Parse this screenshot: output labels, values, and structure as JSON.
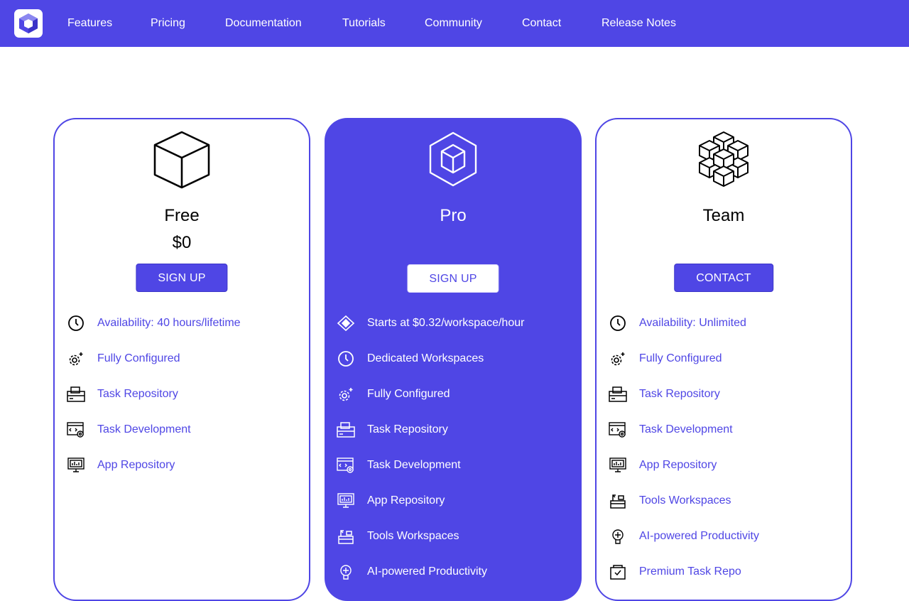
{
  "nav": {
    "logo_icon": "hexagon-cube-logo-icon",
    "links": [
      "Features",
      "Pricing",
      "Documentation",
      "Tutorials",
      "Community",
      "Contact",
      "Release Notes"
    ]
  },
  "colors": {
    "accent": "#4f46e5",
    "white": "#ffffff",
    "text": "#000000"
  },
  "plans": [
    {
      "name": "Free",
      "price": "$0",
      "button": "SIGN UP",
      "icon": "cube-icon",
      "features": [
        {
          "icon": "clock-icon",
          "label": "Availability: 40 hours/lifetime"
        },
        {
          "icon": "gear-sparkle-icon",
          "label": "Fully Configured"
        },
        {
          "icon": "repository-box-icon",
          "label": "Task Repository"
        },
        {
          "icon": "code-window-gear-icon",
          "label": "Task Development"
        },
        {
          "icon": "app-monitor-icon",
          "label": "App Repository"
        }
      ]
    },
    {
      "name": "Pro",
      "button": "SIGN UP",
      "icon": "hexagon-cube-icon",
      "features": [
        {
          "icon": "diamond-tag-icon",
          "label": "Starts at $0.32/workspace/hour"
        },
        {
          "icon": "clock-icon",
          "label": "Dedicated Workspaces"
        },
        {
          "icon": "gear-sparkle-icon",
          "label": "Fully Configured"
        },
        {
          "icon": "repository-box-icon",
          "label": "Task Repository"
        },
        {
          "icon": "code-window-gear-icon",
          "label": "Task Development"
        },
        {
          "icon": "app-monitor-icon",
          "label": "App Repository"
        },
        {
          "icon": "tools-desk-icon",
          "label": "Tools Workspaces"
        },
        {
          "icon": "ai-brain-icon",
          "label": "AI-powered Productivity"
        }
      ]
    },
    {
      "name": "Team",
      "button": "CONTACT",
      "icon": "cube-cluster-icon",
      "features": [
        {
          "icon": "clock-icon",
          "label": "Availability: Unlimited"
        },
        {
          "icon": "gear-sparkle-icon",
          "label": "Fully Configured"
        },
        {
          "icon": "repository-box-icon",
          "label": "Task Repository"
        },
        {
          "icon": "code-window-gear-icon",
          "label": "Task Development"
        },
        {
          "icon": "app-monitor-icon",
          "label": "App Repository"
        },
        {
          "icon": "tools-desk-icon",
          "label": "Tools Workspaces"
        },
        {
          "icon": "ai-brain-icon",
          "label": "AI-powered Productivity"
        },
        {
          "icon": "premium-repo-icon",
          "label": "Premium Task Repo"
        }
      ]
    }
  ]
}
